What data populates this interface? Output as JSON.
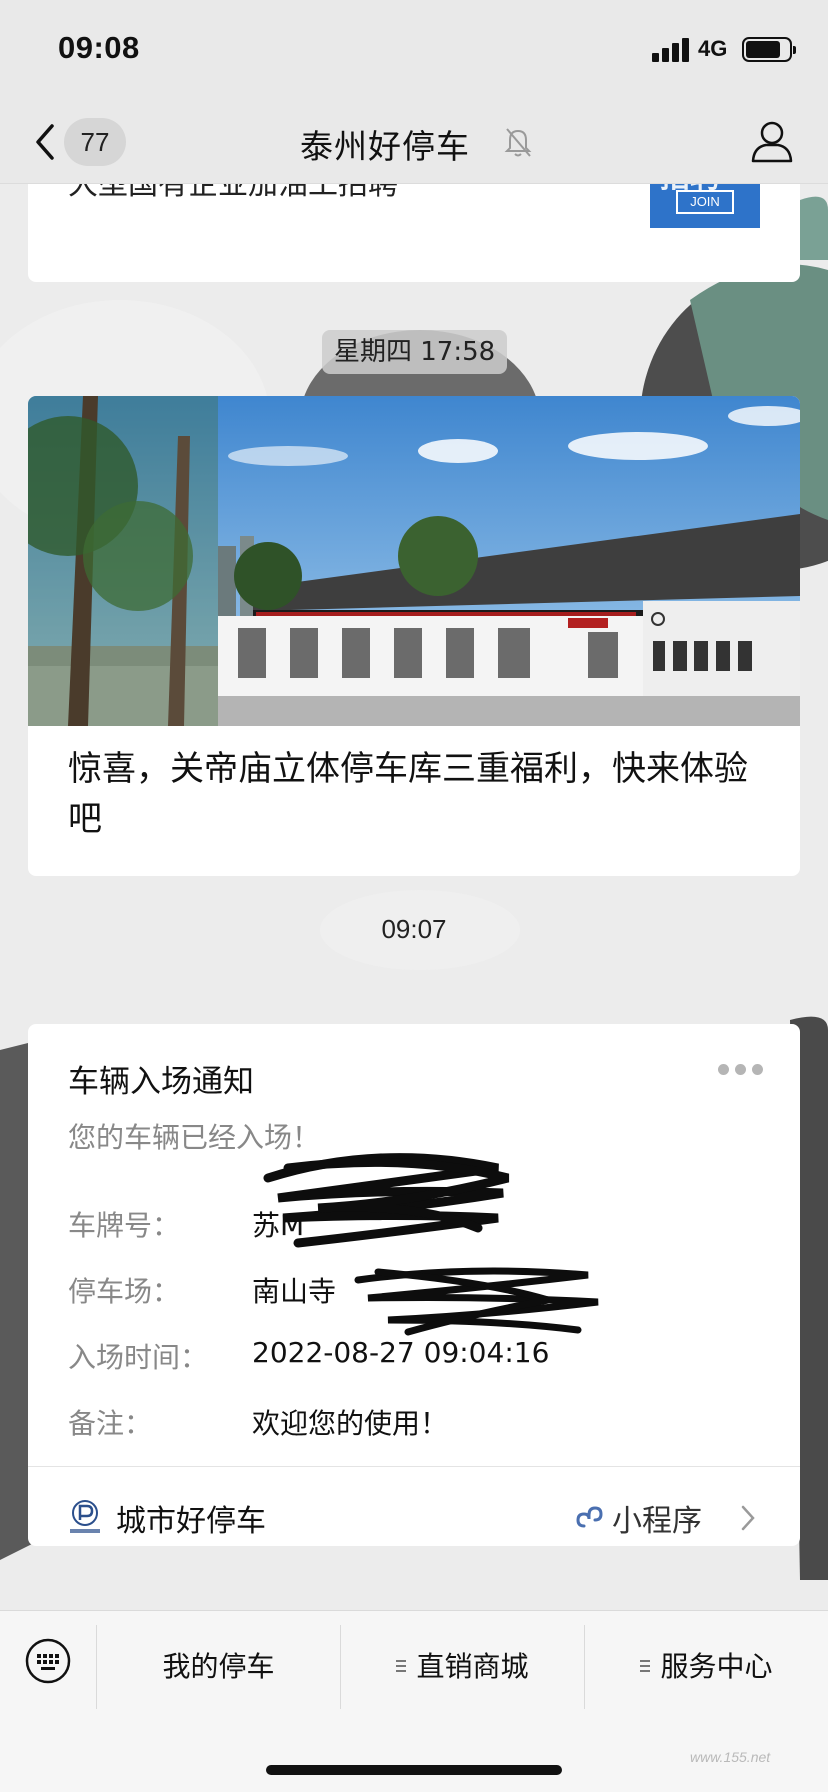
{
  "status_bar": {
    "time": "09:08",
    "network": "4G"
  },
  "nav": {
    "unread_count": "77",
    "title": "泰州好停车"
  },
  "previous_message": {
    "title": "大型国有企业加油工招聘",
    "thumb_big_text": "招聘",
    "thumb_label": "JOIN"
  },
  "article": {
    "timestamp": "星期四 17:58",
    "title": "惊喜，关帝庙立体停车库三重福利，快来体验吧"
  },
  "notice": {
    "timestamp": "09:07",
    "title": "车辆入场通知",
    "subtitle": "您的车辆已经入场！",
    "fields": [
      {
        "label": "车牌号：",
        "value": "苏M"
      },
      {
        "label": "停车场：",
        "value": "南山寺"
      },
      {
        "label": "入场时间：",
        "value": "2022-08-27 09:04:16"
      },
      {
        "label": "备注：",
        "value": "欢迎您的使用！"
      }
    ],
    "source_name": "城市好停车",
    "mini_program_label": "小程序"
  },
  "bottom_menu": {
    "items": [
      {
        "label": "我的停车"
      },
      {
        "label": "直销商城"
      },
      {
        "label": "服务中心"
      }
    ]
  },
  "watermark": "www.155.net",
  "colors": {
    "background": "#ededed",
    "card": "#ffffff",
    "muted_text": "#888888",
    "accent_blue": "#2e73c9"
  }
}
